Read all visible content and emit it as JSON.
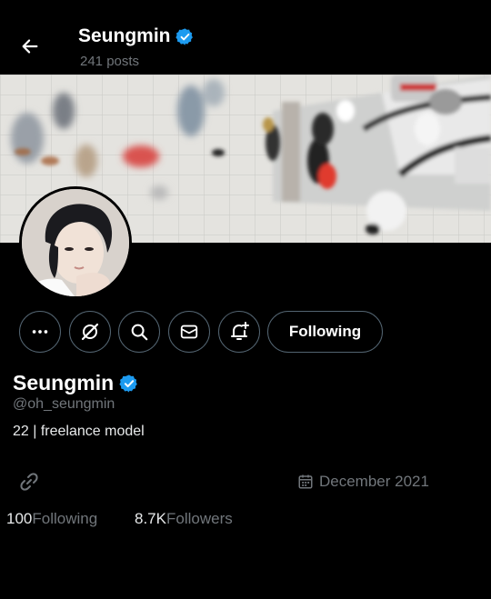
{
  "header": {
    "name": "Seungmin",
    "posts": "241 posts"
  },
  "profile": {
    "name": "Seungmin",
    "handle": "@oh_seungmin",
    "bio": "22 | freelance model",
    "joined": "December 2021",
    "following_count": "100",
    "following_label": "Following",
    "followers_count": "8.7K",
    "followers_label": "Followers"
  },
  "actions": {
    "following_button": "Following",
    "icons": [
      "more-icon",
      "grok-icon",
      "search-icon",
      "message-icon",
      "notification-bell-icon"
    ]
  },
  "colors": {
    "background": "#000000",
    "verified": "#1d9bf0",
    "muted_text": "#71767b",
    "button_border": "#536471"
  }
}
